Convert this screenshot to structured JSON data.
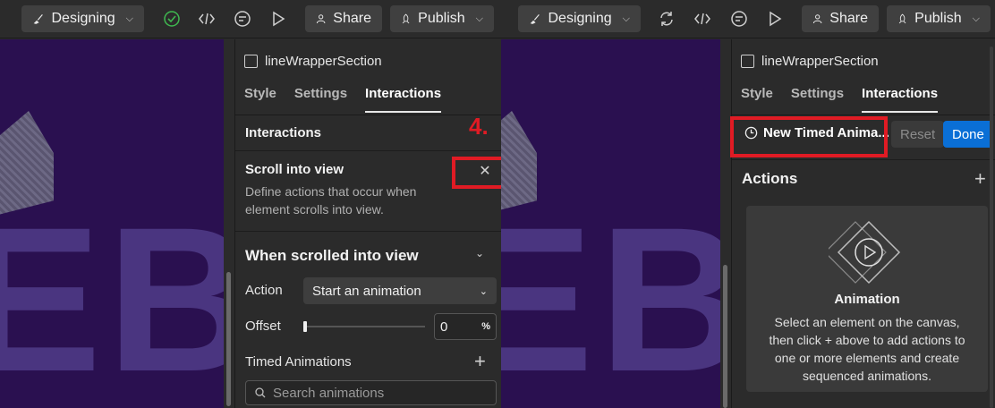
{
  "left": {
    "toolbar": {
      "mode_label": "Designing",
      "share_label": "Share",
      "publish_label": "Publish"
    },
    "canvas": {
      "letters": "EB"
    },
    "panel": {
      "element_name": "lineWrapperSection",
      "tabs": [
        "Style",
        "Settings",
        "Interactions"
      ],
      "active_tab": "Interactions",
      "section_heading": "Interactions",
      "trigger_title": "Scroll into view",
      "trigger_desc_line1": "Define actions that occur when",
      "trigger_desc_line2": "element scrolls into view.",
      "when_heading": "When scrolled into view",
      "action_label": "Action",
      "action_value": "Start an animation",
      "offset_label": "Offset",
      "offset_value": "0",
      "offset_unit": "%",
      "timed_label": "Timed Animations",
      "search_placeholder": "Search animations"
    },
    "annotation": {
      "step": "4."
    }
  },
  "right": {
    "toolbar": {
      "mode_label": "Designing",
      "share_label": "Share",
      "publish_label": "Publish"
    },
    "canvas": {
      "letters": "EB"
    },
    "panel": {
      "element_name": "lineWrapperSection",
      "tabs": [
        "Style",
        "Settings",
        "Interactions"
      ],
      "active_tab": "Interactions",
      "timed_animation_name": "New Timed Anima...",
      "reset_label": "Reset",
      "done_label": "Done",
      "actions_heading": "Actions",
      "card_title": "Animation",
      "card_desc_line1": "Select an element on the canvas,",
      "card_desc_line2": "then click + above to add actions to",
      "card_desc_line3": "one or more elements and create",
      "card_desc_line4": "sequenced animations."
    }
  },
  "colors": {
    "annotation_red": "#e01b24",
    "accent_blue": "#0a6fd6",
    "canvas_purple": "#2a1050",
    "published_green": "#3fb950"
  }
}
